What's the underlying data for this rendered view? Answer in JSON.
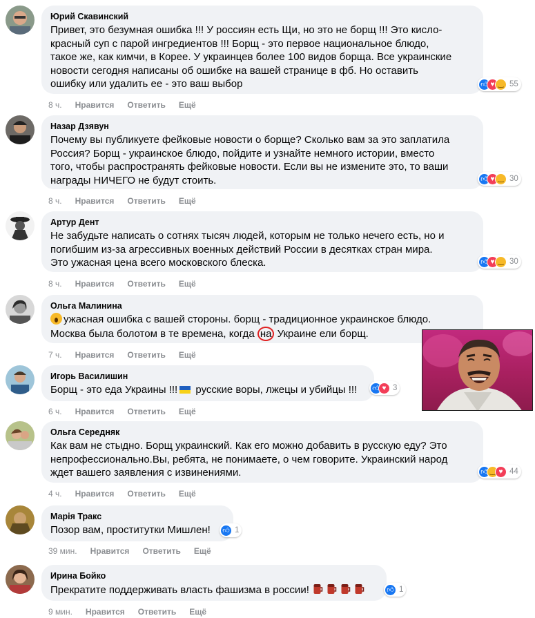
{
  "comments": [
    {
      "author": "Юрий Скавинский",
      "text": "Привет, это безумная ошибка !!! У россиян есть Щи, но это не борщ !!! Это кисло-\nкрасный суп с парой ингредиентов !!! Борщ - это первое национальное блюдо,\nтакое же, как кимчи, в Корее. У украинцев более 100 видов борща. Все украинские\nновости сегодня написаны об ошибке на вашей странице в фб. Но оставить\nошибку или удалить ее - это ваш выбор",
      "time": "8 ч.",
      "reactions": [
        "like",
        "love",
        "haha"
      ],
      "reaction_count": "55"
    },
    {
      "author": "Назар Дзявун",
      "text": "Почему вы публикуете фейковые новости о борще? Сколько вам за это заплатила\nРоссия? Борщ - украинское блюдо, пойдите и узнайте немного истории, вместо\nтого, чтобы распространять фейковые новости. Если вы не измените это, то ваши\nнаграды НИЧЕГО не будут стоить.",
      "time": "8 ч.",
      "reactions": [
        "like",
        "love",
        "haha"
      ],
      "reaction_count": "30"
    },
    {
      "author": "Артур Дент",
      "text": "Не забудьте написать о сотнях тысяч людей, которым не только нечего есть, но и\nпогибшим из-за агрессивных военных действий России в десятках стран мира.\nЭто ужасная цена всего московского блеска.",
      "time": "8 ч.",
      "reactions": [
        "like",
        "love",
        "haha"
      ],
      "reaction_count": "30"
    },
    {
      "author": "Ольга Малинина",
      "text_part1": "ужасная ошибка с вашей стороны. борщ - традиционное украинское блюдо.\nМосква была болотом в те времена, когда ",
      "text_highlight": "на",
      "text_part2": " Украине ели борщ.",
      "time": "7 ч."
    },
    {
      "author": "Игорь Василишин",
      "text_part1": "Борщ - это еда Украины !!!",
      "text_part2": " русские воры, лжецы и убийцы !!!",
      "time": "6 ч.",
      "reactions": [
        "like",
        "love"
      ],
      "reaction_count": "3"
    },
    {
      "author": "Ольга Середняк",
      "text": "Как вам не стыдно. Борщ украинский. Как его можно добавить в русскую еду? Это\nнепрофессионально.Вы, ребята, не понимаете, о чем говорите. Украинский народ\nждет вашего заявления с извинениями.",
      "time": "4 ч.",
      "reactions": [
        "like",
        "haha",
        "love"
      ],
      "reaction_count": "44"
    },
    {
      "author": "Марія Тракс",
      "text": "Позор вам, проститутки Мишлен!",
      "time": "39 мин.",
      "reactions": [
        "like"
      ],
      "reaction_count": "1"
    },
    {
      "author": "Ирина Бойко",
      "text": "Прекратите поддерживать власть фашизма в россии!",
      "time": "9 мин.",
      "reactions": [
        "like"
      ],
      "reaction_count": "1"
    }
  ],
  "action_labels": {
    "like": "Нравится",
    "reply": "Ответить",
    "more": "Ещё"
  },
  "colors": {
    "bubble": "#f0f2f5",
    "meta": "#8a8d91",
    "like": "#1877f2",
    "love": "#f33e58",
    "haha": "#f7b928",
    "highlight": "#e02020"
  }
}
